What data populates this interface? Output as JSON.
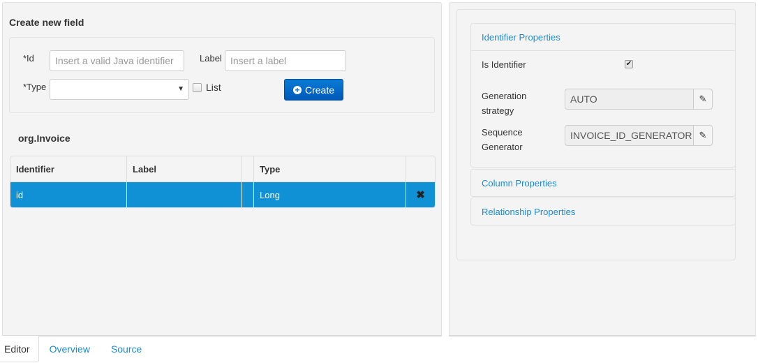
{
  "create_field": {
    "title": "Create new field",
    "id_label": "*Id",
    "id_placeholder": "Insert a valid Java identifier",
    "id_value": "",
    "label_label": "Label",
    "label_placeholder": "Insert a label",
    "label_value": "",
    "type_label": "*Type",
    "type_value": "",
    "list_label": "List",
    "list_checked": false,
    "create_button": "Create"
  },
  "entity": {
    "name": "org.Invoice",
    "columns": [
      "Identifier",
      "Label",
      "",
      "Type",
      ""
    ],
    "rows": [
      {
        "identifier": "id",
        "label": "",
        "type": "Long",
        "selected": true
      }
    ],
    "selected_row_color": "#1091d6"
  },
  "properties": {
    "identifier": {
      "title": "Identifier Properties",
      "is_identifier_label": "Is Identifier",
      "is_identifier_checked": true,
      "generation_strategy_label_1": "Generation",
      "generation_strategy_label_2": "strategy",
      "generation_strategy_value": "AUTO",
      "sequence_generator_label_1": "Sequence",
      "sequence_generator_label_2": "Generator",
      "sequence_generator_value": "INVOICE_ID_GENERATOR"
    },
    "column_title": "Column Properties",
    "relationship_title": "Relationship Properties"
  },
  "tabs": [
    {
      "label": "Editor",
      "active": true
    },
    {
      "label": "Overview",
      "active": false
    },
    {
      "label": "Source",
      "active": false
    }
  ],
  "colors": {
    "accent_link": "#1a8bd1",
    "primary_button": "#0a6fcf",
    "panel_bg": "#f4f4f4"
  }
}
